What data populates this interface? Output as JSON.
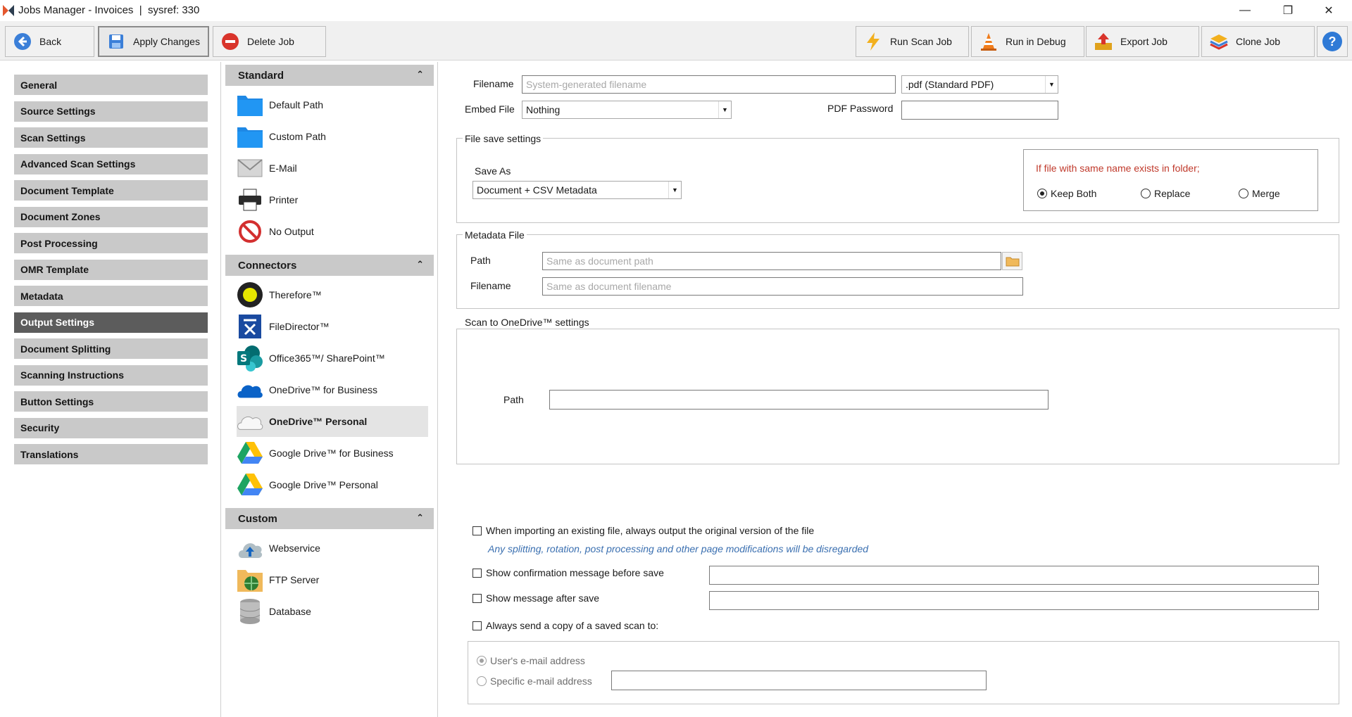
{
  "window": {
    "title": "Jobs Manager - Invoices  |  sysref: 330",
    "minimize_glyph": "—",
    "restore_glyph": "❐",
    "close_glyph": "✕"
  },
  "toolbar": {
    "back": "Back",
    "apply": "Apply Changes",
    "delete": "Delete Job",
    "run_scan": "Run Scan Job",
    "run_debug": "Run in Debug",
    "export": "Export Job",
    "clone": "Clone Job",
    "help": "?"
  },
  "nav": {
    "items": [
      {
        "label": "General"
      },
      {
        "label": "Source Settings"
      },
      {
        "label": "Scan Settings"
      },
      {
        "label": "Advanced Scan Settings"
      },
      {
        "label": "Document Template"
      },
      {
        "label": "Document Zones"
      },
      {
        "label": "Post Processing"
      },
      {
        "label": "OMR Template"
      },
      {
        "label": "Metadata"
      },
      {
        "label": "Output Settings"
      },
      {
        "label": "Document Splitting"
      },
      {
        "label": "Scanning Instructions"
      },
      {
        "label": "Button Settings"
      },
      {
        "label": "Security"
      },
      {
        "label": "Translations"
      }
    ],
    "active": "Output Settings"
  },
  "outputs": {
    "standard_header": "Standard",
    "standard": [
      "Default Path",
      "Custom Path",
      "E-Mail",
      "Printer",
      "No Output"
    ],
    "connectors_header": "Connectors",
    "connectors": [
      "Therefore™",
      "FileDirector™",
      "Office365™/ SharePoint™",
      "OneDrive™ for Business",
      "OneDrive™ Personal",
      "Google Drive™ for Business",
      "Google Drive™ Personal"
    ],
    "custom_header": "Custom",
    "custom": [
      "Webservice",
      "FTP Server",
      "Database"
    ],
    "selected": "OneDrive™ Personal",
    "collapse_glyph": "⌃"
  },
  "form": {
    "filename_label": "Filename",
    "filename_placeholder": "System-generated filename",
    "format_value": ".pdf (Standard PDF)",
    "embed_label": "Embed File",
    "embed_value": "Nothing",
    "pdf_password_label": "PDF Password",
    "pdf_password_value": "",
    "file_save_title": "File save settings",
    "save_as_label": "Save As",
    "save_as_value": "Document + CSV Metadata",
    "exists_label": "If file with same name exists in folder;",
    "exists_options": [
      "Keep Both",
      "Replace",
      "Merge"
    ],
    "exists_selected": "Keep Both",
    "metadata_title": "Metadata File",
    "meta_path_label": "Path",
    "meta_path_placeholder": "Same as document path",
    "meta_filename_label": "Filename",
    "meta_filename_placeholder": "Same as document filename",
    "onedrive_title": "Scan to OneDrive™ settings",
    "onedrive_path_label": "Path",
    "onedrive_path_value": "",
    "import_original_label": "When importing an existing file, always output the original version of the file",
    "import_original_note": "Any splitting, rotation, post processing and other page modifications will be disregarded",
    "confirm_msg_label": "Show confirmation message before save",
    "confirm_msg_value": "",
    "after_msg_label": "Show message after save",
    "after_msg_value": "",
    "send_copy_label": "Always send a copy of a saved scan to:",
    "user_email_label": "User's e-mail address",
    "specific_email_label": "Specific e-mail address",
    "specific_email_value": ""
  },
  "colors": {
    "accent_red": "#c0392b",
    "note_blue": "#3a6fb0",
    "nav_active": "#5c5c5c"
  }
}
